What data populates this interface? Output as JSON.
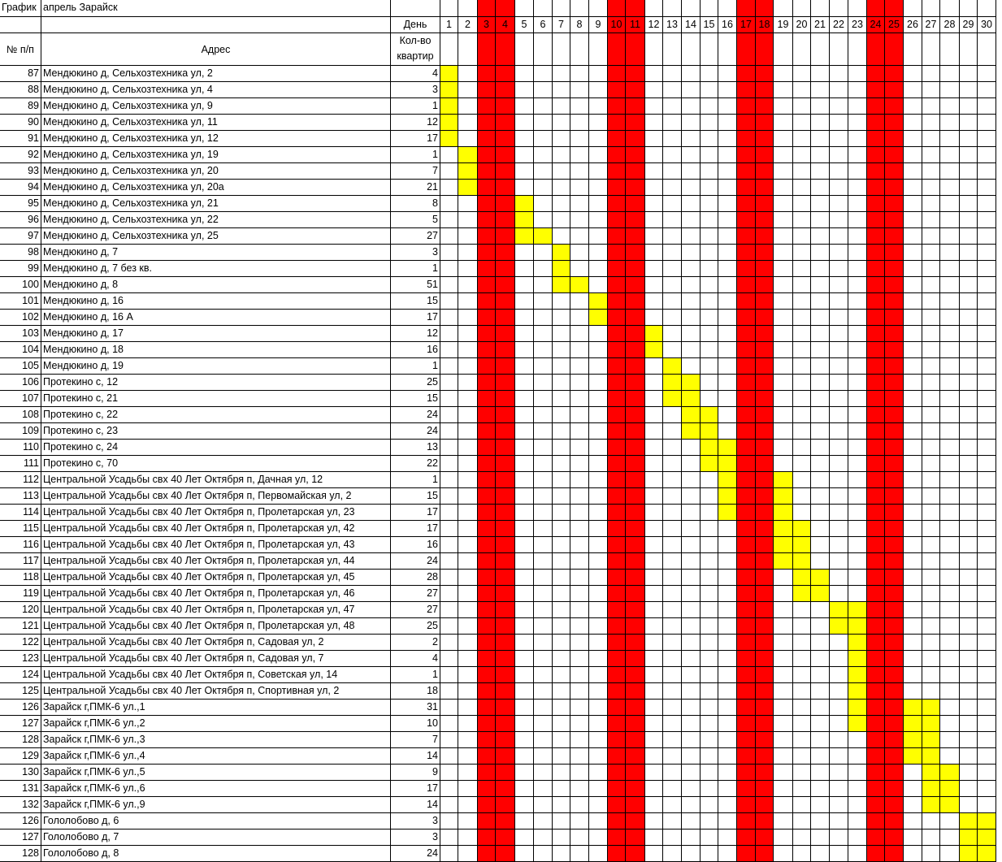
{
  "title": {
    "label": "График",
    "value": "апрель Зарайск"
  },
  "header": {
    "day_label": "День",
    "col_num": "№ п/п",
    "col_addr": "Адрес",
    "col_qty": "Кол-во квартир"
  },
  "colors": {
    "weekend": "#ff0000",
    "scheduled": "#ffff00"
  },
  "days": [
    1,
    2,
    3,
    4,
    5,
    6,
    7,
    8,
    9,
    10,
    11,
    12,
    13,
    14,
    15,
    16,
    17,
    18,
    19,
    20,
    21,
    22,
    23,
    24,
    25,
    26,
    27,
    28,
    29,
    30
  ],
  "weekend_days": [
    3,
    4,
    10,
    11,
    17,
    18,
    24,
    25
  ],
  "rows": [
    {
      "n": "87",
      "addr": "Мендюкино д, Сельхозтехника ул, 2",
      "qty": "4",
      "days": [
        1
      ]
    },
    {
      "n": "88",
      "addr": "Мендюкино д, Сельхозтехника ул, 4",
      "qty": "3",
      "days": [
        1
      ]
    },
    {
      "n": "89",
      "addr": "Мендюкино д, Сельхозтехника ул, 9",
      "qty": "1",
      "days": [
        1
      ]
    },
    {
      "n": "90",
      "addr": "Мендюкино д, Сельхозтехника ул, 11",
      "qty": "12",
      "days": [
        1
      ]
    },
    {
      "n": "91",
      "addr": "Мендюкино д, Сельхозтехника ул, 12",
      "qty": "17",
      "days": [
        1
      ]
    },
    {
      "n": "92",
      "addr": "Мендюкино д, Сельхозтехника ул, 19",
      "qty": "1",
      "days": [
        2
      ]
    },
    {
      "n": "93",
      "addr": "Мендюкино д, Сельхозтехника ул, 20",
      "qty": "7",
      "days": [
        2
      ]
    },
    {
      "n": "94",
      "addr": "Мендюкино д, Сельхозтехника ул, 20а",
      "qty": "21",
      "days": [
        2
      ]
    },
    {
      "n": "95",
      "addr": "Мендюкино д, Сельхозтехника ул, 21",
      "qty": "8",
      "days": [
        5
      ]
    },
    {
      "n": "96",
      "addr": "Мендюкино д, Сельхозтехника ул, 22",
      "qty": "5",
      "days": [
        5
      ]
    },
    {
      "n": "97",
      "addr": "Мендюкино д, Сельхозтехника ул, 25",
      "qty": "27",
      "days": [
        5,
        6
      ]
    },
    {
      "n": "98",
      "addr": "Мендюкино д, 7",
      "qty": "3",
      "days": [
        7
      ]
    },
    {
      "n": "99",
      "addr": "Мендюкино д, 7 без кв.",
      "qty": "1",
      "days": [
        7
      ]
    },
    {
      "n": "100",
      "addr": "Мендюкино д, 8",
      "qty": "51",
      "days": [
        7,
        8
      ]
    },
    {
      "n": "101",
      "addr": "Мендюкино д, 16",
      "qty": "15",
      "days": [
        9
      ]
    },
    {
      "n": "102",
      "addr": "Мендюкино д, 16 А",
      "qty": "17",
      "days": [
        9
      ]
    },
    {
      "n": "103",
      "addr": "Мендюкино д, 17",
      "qty": "12",
      "days": [
        12
      ]
    },
    {
      "n": "104",
      "addr": "Мендюкино д, 18",
      "qty": "16",
      "days": [
        12
      ]
    },
    {
      "n": "105",
      "addr": "Мендюкино д, 19",
      "qty": "1",
      "days": [
        13
      ]
    },
    {
      "n": "106",
      "addr": "Протекино с, 12",
      "qty": "25",
      "days": [
        13,
        14
      ]
    },
    {
      "n": "107",
      "addr": "Протекино с, 21",
      "qty": "15",
      "days": [
        13,
        14
      ]
    },
    {
      "n": "108",
      "addr": "Протекино с, 22",
      "qty": "24",
      "days": [
        14,
        15
      ]
    },
    {
      "n": "109",
      "addr": "Протекино с, 23",
      "qty": "24",
      "days": [
        14,
        15
      ]
    },
    {
      "n": "110",
      "addr": "Протекино с, 24",
      "qty": "13",
      "days": [
        15,
        16
      ]
    },
    {
      "n": "111",
      "addr": "Протекино с, 70",
      "qty": "22",
      "days": [
        15,
        16
      ]
    },
    {
      "n": "112",
      "addr": "Центральной Усадьбы свх 40 Лет Октября п, Дачная ул, 12",
      "qty": "1",
      "days": [
        16,
        19
      ]
    },
    {
      "n": "113",
      "addr": "Центральной Усадьбы свх 40 Лет Октября п, Первомайская ул, 2",
      "qty": "15",
      "days": [
        16,
        19
      ]
    },
    {
      "n": "114",
      "addr": "Центральной Усадьбы свх 40 Лет Октября п, Пролетарская ул, 23",
      "qty": "17",
      "days": [
        16,
        19
      ]
    },
    {
      "n": "115",
      "addr": "Центральной Усадьбы свх 40 Лет Октября п, Пролетарская ул, 42",
      "qty": "17",
      "days": [
        19,
        20
      ]
    },
    {
      "n": "116",
      "addr": "Центральной Усадьбы свх 40 Лет Октября п, Пролетарская ул, 43",
      "qty": "16",
      "days": [
        19,
        20
      ]
    },
    {
      "n": "117",
      "addr": "Центральной Усадьбы свх 40 Лет Октября п, Пролетарская ул, 44",
      "qty": "24",
      "days": [
        19,
        20
      ]
    },
    {
      "n": "118",
      "addr": "Центральной Усадьбы свх 40 Лет Октября п, Пролетарская ул, 45",
      "qty": "28",
      "days": [
        20,
        21
      ]
    },
    {
      "n": "119",
      "addr": "Центральной Усадьбы свх 40 Лет Октября п, Пролетарская ул, 46",
      "qty": "27",
      "days": [
        20,
        21
      ]
    },
    {
      "n": "120",
      "addr": "Центральной Усадьбы свх 40 Лет Октября п, Пролетарская ул, 47",
      "qty": "27",
      "days": [
        22,
        23
      ]
    },
    {
      "n": "121",
      "addr": "Центральной Усадьбы свх 40 Лет Октября п, Пролетарская ул, 48",
      "qty": "25",
      "days": [
        22,
        23
      ]
    },
    {
      "n": "122",
      "addr": "Центральной Усадьбы свх 40 Лет Октября п, Садовая ул, 2",
      "qty": "2",
      "days": [
        23
      ]
    },
    {
      "n": "123",
      "addr": "Центральной Усадьбы свх 40 Лет Октября п, Садовая ул, 7",
      "qty": "4",
      "days": [
        23
      ]
    },
    {
      "n": "124",
      "addr": "Центральной Усадьбы свх 40 Лет Октября п, Советская ул, 14",
      "qty": "1",
      "days": [
        23
      ]
    },
    {
      "n": "125",
      "addr": "Центральной Усадьбы свх 40 Лет Октября п, Спортивная ул, 2",
      "qty": "18",
      "days": [
        23
      ]
    },
    {
      "n": "126",
      "addr": "Зарайск г,ПМК-6 ул.,1",
      "qty": "31",
      "days": [
        23,
        26,
        27
      ]
    },
    {
      "n": "127",
      "addr": "Зарайск г,ПМК-6 ул.,2",
      "qty": "10",
      "days": [
        23,
        26,
        27
      ]
    },
    {
      "n": "128",
      "addr": "Зарайск г,ПМК-6 ул.,3",
      "qty": "7",
      "days": [
        26,
        27
      ]
    },
    {
      "n": "129",
      "addr": "Зарайск г,ПМК-6 ул.,4",
      "qty": "14",
      "days": [
        26,
        27
      ]
    },
    {
      "n": "130",
      "addr": "Зарайск г,ПМК-6 ул.,5",
      "qty": "9",
      "days": [
        27,
        28
      ]
    },
    {
      "n": "131",
      "addr": "Зарайск г,ПМК-6 ул.,6",
      "qty": "17",
      "days": [
        27,
        28
      ]
    },
    {
      "n": "132",
      "addr": "Зарайск г,ПМК-6 ул.,9",
      "qty": "14",
      "days": [
        27,
        28
      ]
    },
    {
      "n": "126",
      "addr": "Гололобово д, 6",
      "qty": "3",
      "days": [
        29,
        30
      ]
    },
    {
      "n": "127",
      "addr": "Гололобово д, 7",
      "qty": "3",
      "days": [
        29,
        30
      ]
    },
    {
      "n": "128",
      "addr": "Гололобово д, 8",
      "qty": "24",
      "days": [
        29,
        30
      ]
    }
  ]
}
